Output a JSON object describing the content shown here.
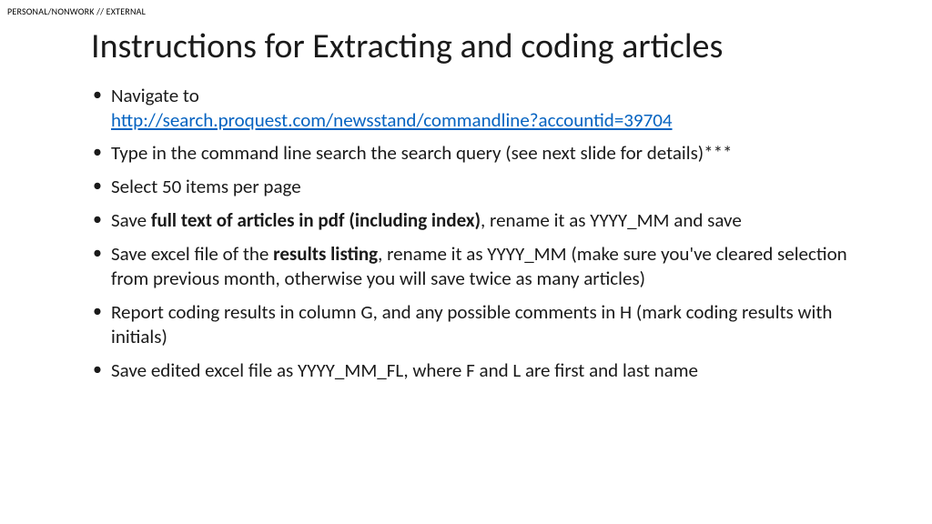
{
  "classification": "PERSONAL/NONWORK // EXTERNAL",
  "title": "Instructions for Extracting and coding articles",
  "bullets": {
    "b1_prefix": "Navigate to ",
    "b1_link": "http://search.proquest.com/newsstand/commandline?accountid=39704",
    "b2": "Type in the command line search the search query (see next slide for details)***",
    "b3": "Select 50 items per page",
    "b4_a": "Save ",
    "b4_bold": "full text of articles in pdf (including index)",
    "b4_c": ", rename it as YYYY_MM and save",
    "b5_a": "Save excel file of the ",
    "b5_bold": "results listing",
    "b5_c": ", rename it as YYYY_MM (make sure you've cleared selection from previous month, otherwise you will save twice as many articles)",
    "b6": "Report coding results in column G, and any possible comments in H (mark coding results with initials)",
    "b7": "Save edited excel file as YYYY_MM_FL, where F and L are first and last name"
  }
}
